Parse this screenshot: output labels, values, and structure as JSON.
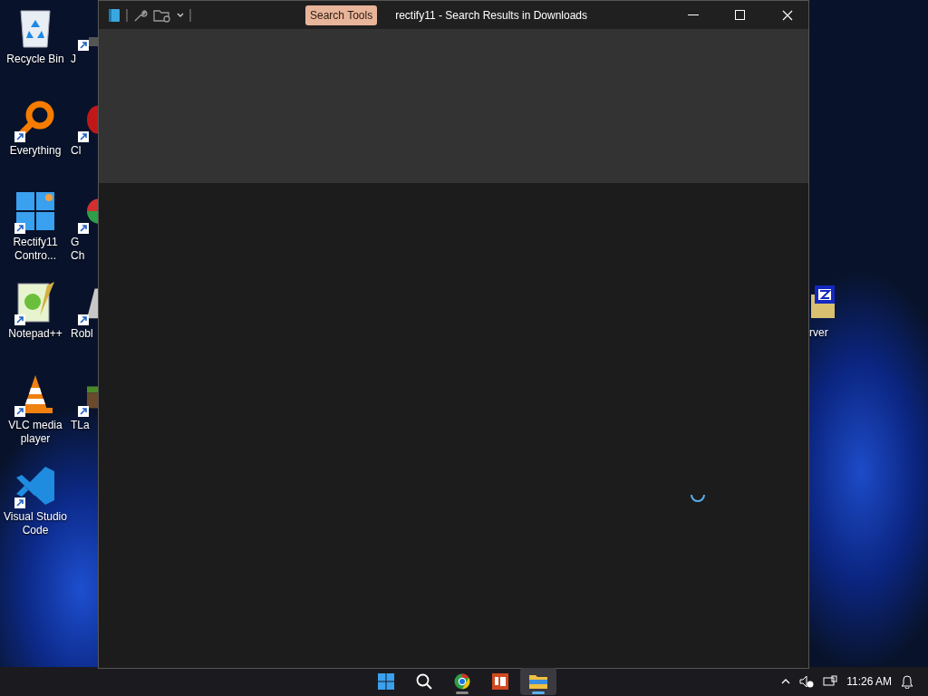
{
  "desktop_columns": [
    {
      "icons": [
        {
          "kind": "recycle-bin",
          "label": "Recycle Bin",
          "shortcut": false
        },
        {
          "kind": "magnifier",
          "label": "Everything",
          "shortcut": true
        },
        {
          "kind": "windows-logo",
          "label": "Rectify11 Contro...",
          "shortcut": true
        },
        {
          "kind": "notepad",
          "label": "Notepad++",
          "shortcut": true
        },
        {
          "kind": "cone",
          "label": "VLC media player",
          "shortcut": true
        },
        {
          "kind": "code",
          "label": "Visual Studio Code",
          "shortcut": true
        }
      ]
    },
    {
      "icons": [
        {
          "kind": "blank",
          "label": "J",
          "shortcut": true
        },
        {
          "kind": "red-ball",
          "label": "Cl",
          "shortcut": true
        },
        {
          "kind": "colored-ball",
          "label": "G Ch",
          "shortcut": true
        },
        {
          "kind": "grey-shape",
          "label": "Robl",
          "shortcut": true
        },
        {
          "kind": "grass-block",
          "label": "TLa",
          "shortcut": true
        }
      ]
    }
  ],
  "right_icon": {
    "kind": "archive",
    "label": "rver"
  },
  "window": {
    "title": "rectify11 - Search Results in Downloads",
    "context_tab": "Search Tools",
    "loading": true
  },
  "taskbar": {
    "apps": [
      {
        "kind": "start",
        "running": false,
        "active": false
      },
      {
        "kind": "search",
        "running": false,
        "active": false
      },
      {
        "kind": "browser",
        "running": true,
        "active": false
      },
      {
        "kind": "slides",
        "running": false,
        "active": false
      },
      {
        "kind": "folder",
        "running": true,
        "active": true
      }
    ],
    "clock": "11:26 AM"
  }
}
